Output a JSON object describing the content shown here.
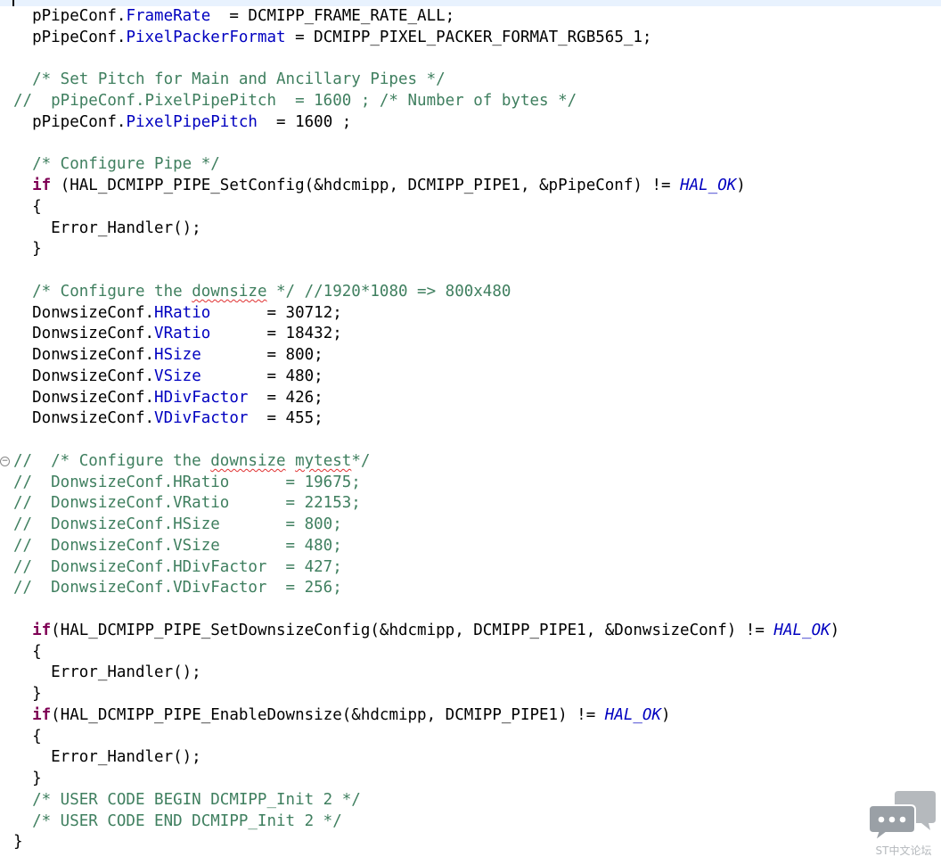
{
  "editor": {
    "lines": [
      [
        {
          "t": "  pPipeConf."
        },
        {
          "t": "FrameRate",
          "c": "fld"
        },
        {
          "t": "  = DCMIPP_FRAME_RATE_ALL;"
        }
      ],
      [
        {
          "t": "  pPipeConf."
        },
        {
          "t": "PixelPackerFormat",
          "c": "fld"
        },
        {
          "t": " = DCMIPP_PIXEL_PACKER_FORMAT_RGB565_1;"
        }
      ],
      [],
      [
        {
          "t": "  /* Set Pitch for Main and Ancillary Pipes */",
          "c": "c"
        }
      ],
      [
        {
          "t": "//  pPipeConf.PixelPipePitch  = 1600 ; /* Number of bytes */",
          "c": "c"
        }
      ],
      [
        {
          "t": "  pPipeConf."
        },
        {
          "t": "PixelPipePitch",
          "c": "fld"
        },
        {
          "t": "  = 1600 ;"
        }
      ],
      [],
      [
        {
          "t": "  /* Configure Pipe */",
          "c": "c"
        }
      ],
      [
        {
          "t": "  "
        },
        {
          "t": "if",
          "c": "kw"
        },
        {
          "t": " (HAL_DCMIPP_PIPE_SetConfig(&hdcmipp, DCMIPP_PIPE1, &pPipeConf) != "
        },
        {
          "t": "HAL_OK",
          "c": "em"
        },
        {
          "t": ")"
        }
      ],
      [
        {
          "t": "  {"
        }
      ],
      [
        {
          "t": "    Error_Handler();"
        }
      ],
      [
        {
          "t": "  }"
        }
      ],
      [],
      [
        {
          "t": "  /* Configure the ",
          "c": "c"
        },
        {
          "t": "downsize",
          "c": "c sq"
        },
        {
          "t": " */ //1920*1080 => 800x480",
          "c": "c"
        }
      ],
      [
        {
          "t": "  DonwsizeConf."
        },
        {
          "t": "HRatio",
          "c": "fld"
        },
        {
          "t": "      = 30712;"
        }
      ],
      [
        {
          "t": "  DonwsizeConf."
        },
        {
          "t": "VRatio",
          "c": "fld"
        },
        {
          "t": "      = 18432;"
        }
      ],
      [
        {
          "t": "  DonwsizeConf."
        },
        {
          "t": "HSize",
          "c": "fld"
        },
        {
          "t": "       = 800;"
        }
      ],
      [
        {
          "t": "  DonwsizeConf."
        },
        {
          "t": "VSize",
          "c": "fld"
        },
        {
          "t": "       = 480;"
        }
      ],
      [
        {
          "t": "  DonwsizeConf."
        },
        {
          "t": "HDivFactor",
          "c": "fld"
        },
        {
          "t": "  = 426;"
        }
      ],
      [
        {
          "t": "  DonwsizeConf."
        },
        {
          "t": "VDivFactor",
          "c": "fld"
        },
        {
          "t": "  = 455;"
        }
      ],
      [],
      [
        {
          "t": "//  /* Configure the ",
          "c": "c"
        },
        {
          "t": "downsize",
          "c": "c sq"
        },
        {
          "t": " ",
          "c": "c"
        },
        {
          "t": "mytest",
          "c": "c sq"
        },
        {
          "t": "*/",
          "c": "c"
        }
      ],
      [
        {
          "t": "//  DonwsizeConf.HRatio      = 19675;",
          "c": "c"
        }
      ],
      [
        {
          "t": "//  DonwsizeConf.VRatio      = 22153;",
          "c": "c"
        }
      ],
      [
        {
          "t": "//  DonwsizeConf.HSize       = 800;",
          "c": "c"
        }
      ],
      [
        {
          "t": "//  DonwsizeConf.VSize       = 480;",
          "c": "c"
        }
      ],
      [
        {
          "t": "//  DonwsizeConf.HDivFactor  = 427;",
          "c": "c"
        }
      ],
      [
        {
          "t": "//  DonwsizeConf.VDivFactor  = 256;",
          "c": "c"
        }
      ],
      [],
      [
        {
          "t": "  "
        },
        {
          "t": "if",
          "c": "kw"
        },
        {
          "t": "(HAL_DCMIPP_PIPE_SetDownsizeConfig(&hdcmipp, DCMIPP_PIPE1, &DonwsizeConf) != "
        },
        {
          "t": "HAL_OK",
          "c": "em"
        },
        {
          "t": ")"
        }
      ],
      [
        {
          "t": "  {"
        }
      ],
      [
        {
          "t": "    Error_Handler();"
        }
      ],
      [
        {
          "t": "  }"
        }
      ],
      [
        {
          "t": "  "
        },
        {
          "t": "if",
          "c": "kw"
        },
        {
          "t": "(HAL_DCMIPP_PIPE_EnableDownsize(&hdcmipp, DCMIPP_PIPE1) != "
        },
        {
          "t": "HAL_OK",
          "c": "em"
        },
        {
          "t": ")"
        }
      ],
      [
        {
          "t": "  {"
        }
      ],
      [
        {
          "t": "    Error_Handler();"
        }
      ],
      [
        {
          "t": "  }"
        }
      ],
      [
        {
          "t": "  /* USER CODE BEGIN DCMIPP_Init 2 */",
          "c": "c"
        }
      ],
      [
        {
          "t": "  /* USER CODE END DCMIPP_Init 2 */",
          "c": "c"
        }
      ],
      [
        {
          "t": "}"
        }
      ]
    ],
    "fold_marker": {
      "line": 21,
      "icon": "collapse-minus-icon",
      "glyph": "−"
    }
  },
  "watermark": {
    "icon": "chat-bubbles-icon",
    "label": "ST中文论坛",
    "color": "#b5b9bd"
  }
}
